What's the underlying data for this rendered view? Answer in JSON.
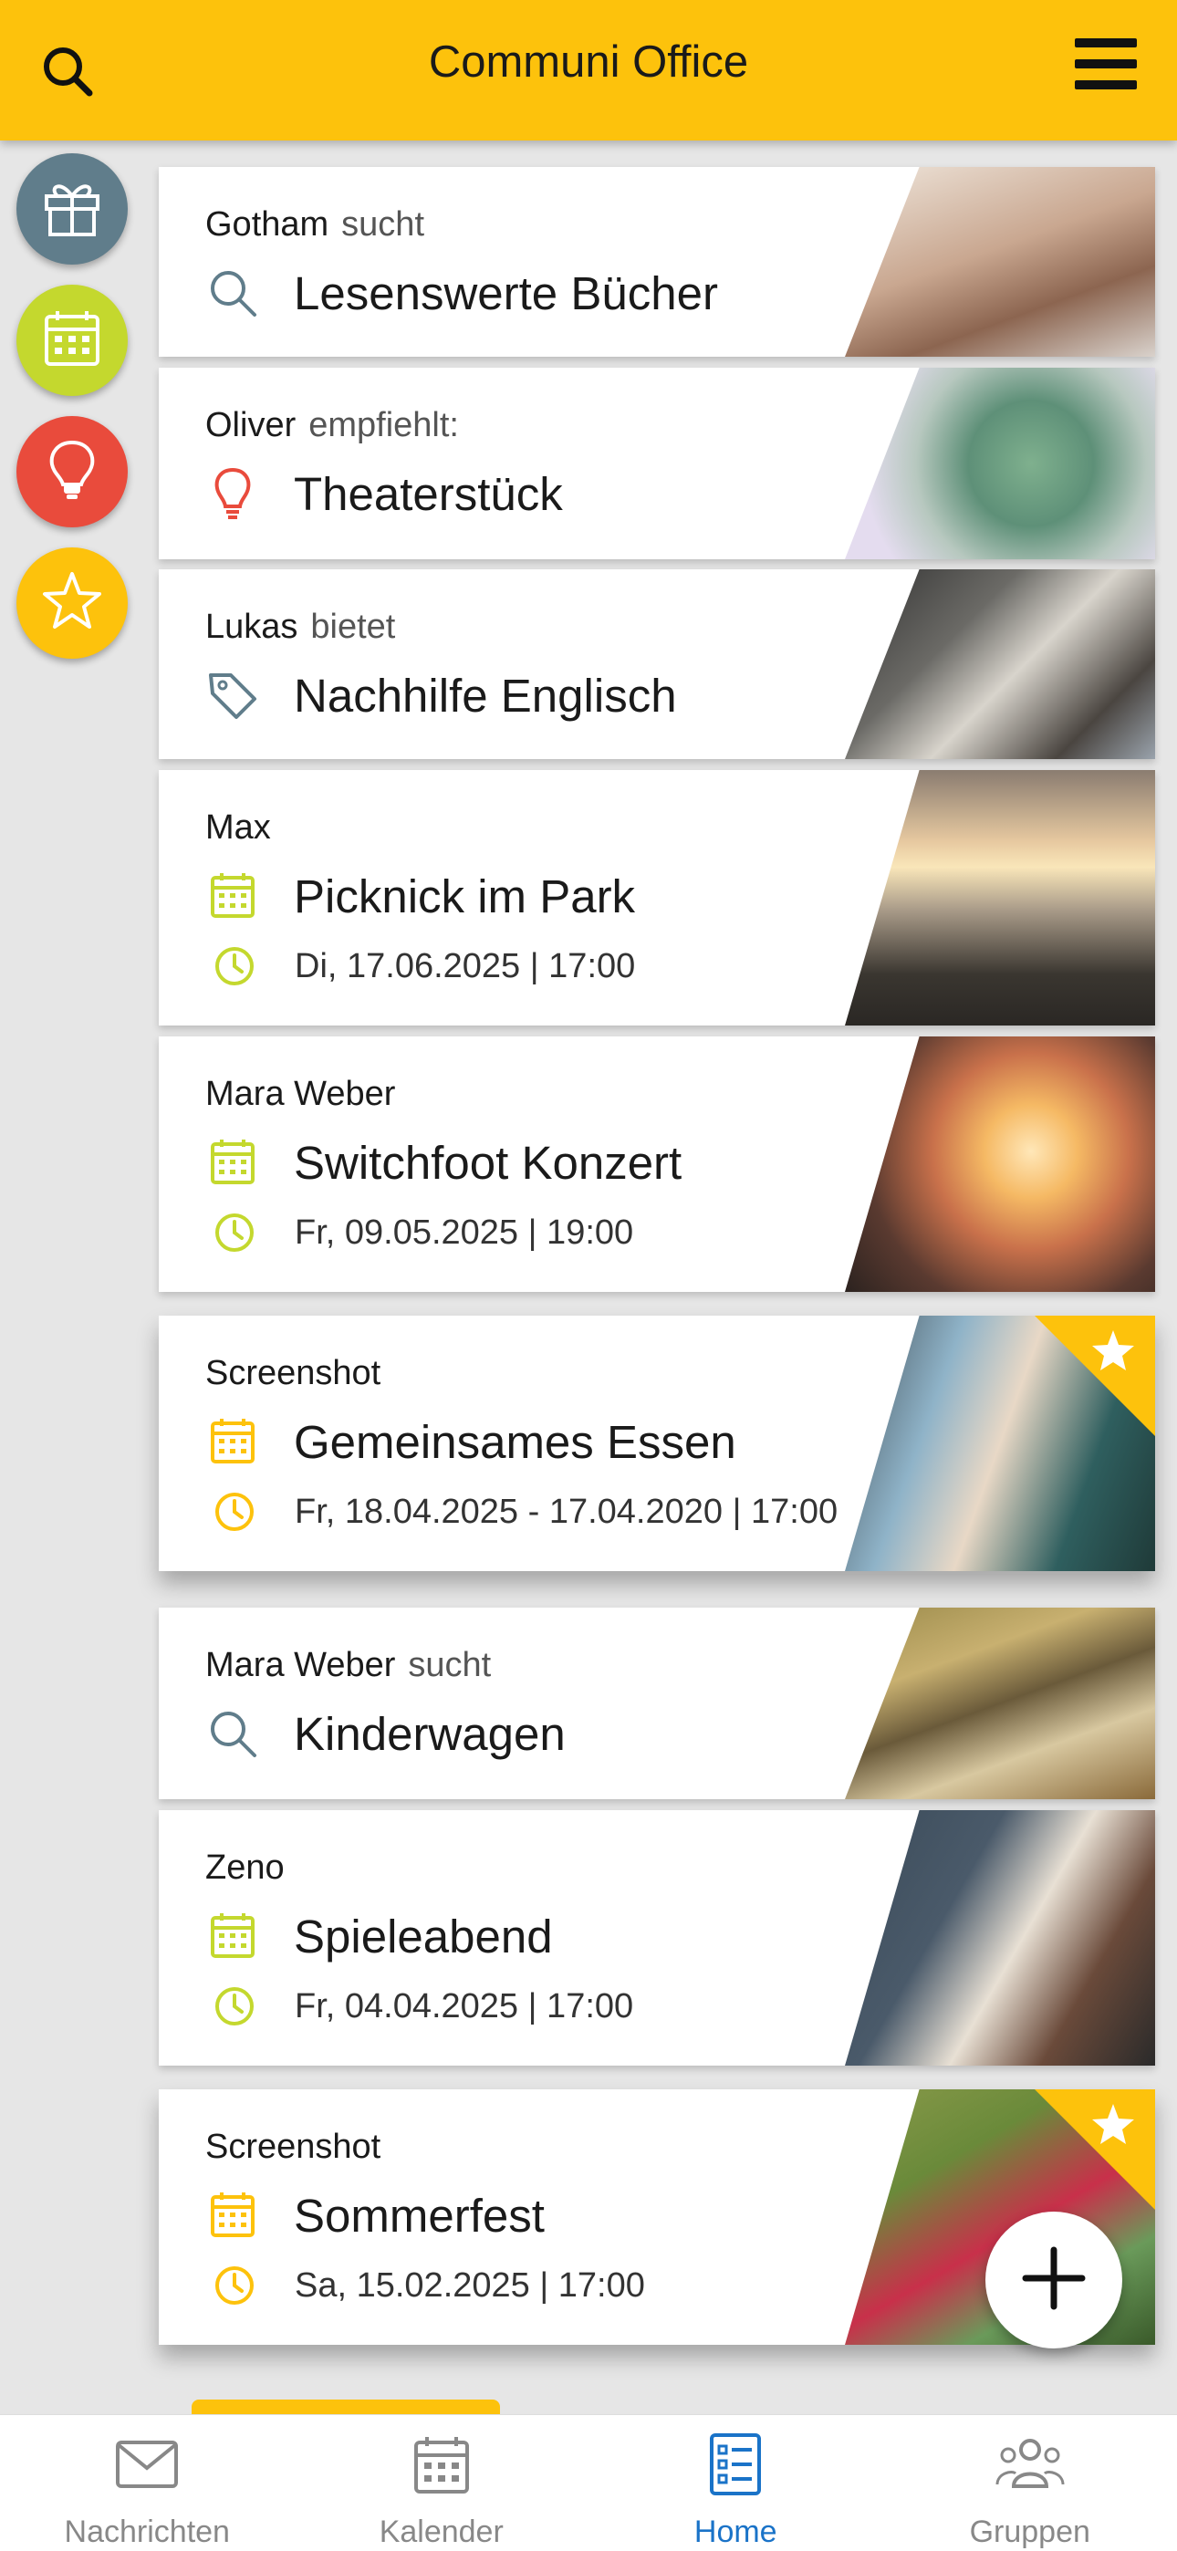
{
  "app": {
    "title": "Communi Office"
  },
  "colors": {
    "brand": "#fdc20c",
    "accent_blue": "#1a73c8",
    "green": "#c4d82e",
    "red": "#e94b3c",
    "slate": "#607d8b"
  },
  "side_buttons": [
    {
      "name": "gift",
      "color": "#607d8b",
      "icon": "gift-icon"
    },
    {
      "name": "calendar",
      "color": "#c4d82e",
      "icon": "calendar-icon"
    },
    {
      "name": "idea",
      "color": "#e94b3c",
      "icon": "lightbulb-icon"
    },
    {
      "name": "favorites",
      "color": "#fdc20c",
      "icon": "star-icon"
    }
  ],
  "cards": [
    {
      "user": "Gotham",
      "action": "sucht",
      "title": "Lesenswerte Bücher",
      "icon": "search-icon"
    },
    {
      "user": "Oliver",
      "action": "empfiehlt:",
      "title": "Theaterstück",
      "icon": "lightbulb-icon"
    },
    {
      "user": "Lukas",
      "action": "bietet",
      "title": "Nachhilfe Englisch",
      "icon": "tag-icon"
    },
    {
      "user": "Max",
      "title": "Picknick im Park",
      "date": "Di, 17.06.2025 | 17:00",
      "icon": "calendar-icon"
    },
    {
      "user": "Mara Weber",
      "title": "Switchfoot Konzert",
      "date": "Fr, 09.05.2025 | 19:00",
      "icon": "calendar-icon"
    },
    {
      "user": "Screenshot",
      "title": "Gemeinsames Essen",
      "date": "Fr, 18.04.2025 - 17.04.2020 | 17:00",
      "icon": "calendar-icon",
      "starred": true
    },
    {
      "user": "Mara Weber",
      "action": "sucht",
      "title": "Kinderwagen",
      "icon": "search-icon"
    },
    {
      "user": "Zeno",
      "title": "Spieleabend",
      "date": "Fr, 04.04.2025 | 17:00",
      "icon": "calendar-icon"
    },
    {
      "user": "Screenshot",
      "title": "Sommerfest",
      "date": "Sa, 15.02.2025 | 17:00",
      "icon": "calendar-icon",
      "starred": true
    }
  ],
  "bottom_nav": [
    {
      "label": "Nachrichten",
      "icon": "mail-icon",
      "active": false
    },
    {
      "label": "Kalender",
      "icon": "calendar-icon",
      "active": false
    },
    {
      "label": "Home",
      "icon": "list-icon",
      "active": true
    },
    {
      "label": "Gruppen",
      "icon": "group-icon",
      "active": false
    }
  ]
}
